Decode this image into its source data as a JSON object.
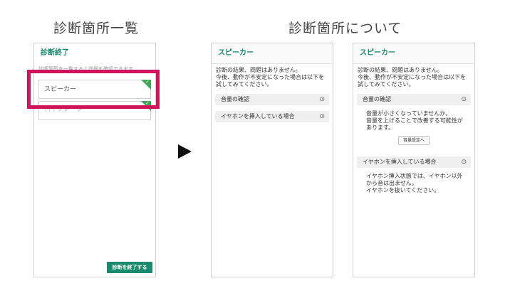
{
  "headings": {
    "left": "診断箇所一覧",
    "right": "診断箇所について"
  },
  "screen1": {
    "title": "診断終了",
    "hint": "診断箇所を一覧すると詳細を確認できます",
    "items": [
      "スピーカー",
      "バイブレータ"
    ],
    "end_button": "診断を終了する"
  },
  "screen2": {
    "title": "スピーカー",
    "result_text": "診断の結果、問題はありません。\n今後、動作が不安定になった場合は以下を試してみてください。",
    "sections": [
      {
        "label": "音量の確認",
        "icon": "⊙"
      },
      {
        "label": "イヤホンを挿入している場合",
        "icon": "⊙"
      }
    ]
  },
  "screen3": {
    "title": "スピーカー",
    "result_text": "診断の結果、問題はありません。\n今後、動作が不安定になった場合は以下を試してみてください。",
    "sections": [
      {
        "label": "音量の確認",
        "icon": "⊙",
        "body": "音量が小さくなっていませんか。\n音量を上げることで改善する可能性があります。",
        "button": "音量設定へ"
      },
      {
        "label": "イヤホンを挿入している場合",
        "icon": "⊙",
        "body": "イヤホン挿入状態では、イヤホン以外から音は出ません。\nイヤホンを抜いてください。"
      }
    ]
  },
  "colors": {
    "accent": "#1a8a6e",
    "highlight_frame": "#d0145a",
    "corner_badge": "#3aa656"
  }
}
